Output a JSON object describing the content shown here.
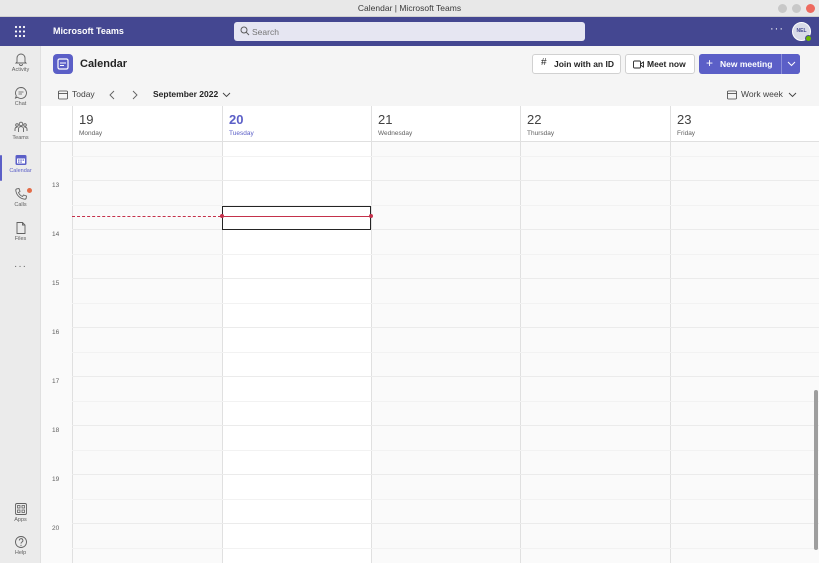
{
  "window": {
    "title": "Calendar | Microsoft Teams"
  },
  "colors": {
    "brand": "#444791",
    "accent": "#5b5fc7",
    "now_line": "#c4314b",
    "presence": "#6bb700"
  },
  "app_header": {
    "app_name": "Microsoft Teams",
    "search_placeholder": "Search",
    "more_label": "···",
    "avatar_initials": "NEL"
  },
  "rail": {
    "items": [
      {
        "label": "Activity",
        "icon": "bell-icon"
      },
      {
        "label": "Chat",
        "icon": "chat-icon"
      },
      {
        "label": "Teams",
        "icon": "teams-icon"
      },
      {
        "label": "Calendar",
        "icon": "calendar-icon",
        "active": true
      },
      {
        "label": "Calls",
        "icon": "phone-icon",
        "badge": true
      },
      {
        "label": "Files",
        "icon": "file-icon"
      }
    ],
    "more_label": "···",
    "bottom": [
      {
        "label": "Apps",
        "icon": "apps-icon"
      },
      {
        "label": "Help",
        "icon": "help-icon"
      }
    ]
  },
  "calendar": {
    "title": "Calendar",
    "join_label": "Join with an ID",
    "meet_now_label": "Meet now",
    "new_meeting_label": "New meeting",
    "today_label": "Today",
    "month_label": "September 2022",
    "view_label": "Work week",
    "days": [
      {
        "num": "19",
        "weekday": "Monday"
      },
      {
        "num": "20",
        "weekday": "Tuesday",
        "today": true
      },
      {
        "num": "21",
        "weekday": "Wednesday"
      },
      {
        "num": "22",
        "weekday": "Thursday"
      },
      {
        "num": "23",
        "weekday": "Friday"
      }
    ],
    "hours": [
      "13",
      "14",
      "15",
      "16",
      "17",
      "18",
      "19",
      "20"
    ]
  }
}
